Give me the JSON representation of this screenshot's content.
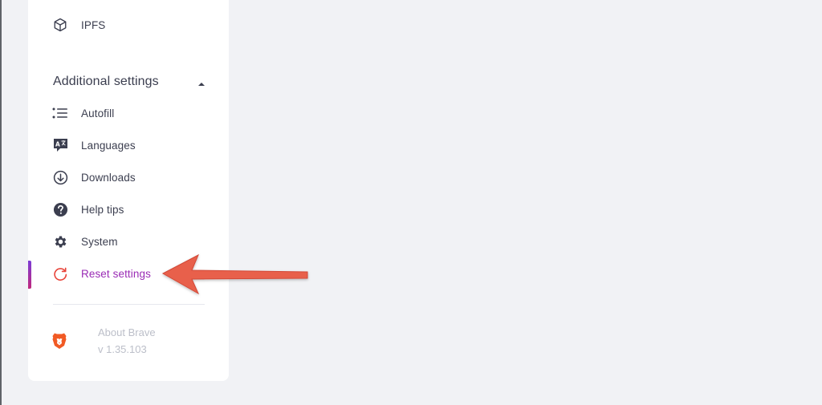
{
  "sidebar": {
    "ipfs_label": "IPFS",
    "additional_settings": {
      "title": "Additional settings",
      "expanded": true,
      "items": [
        {
          "label": "Autofill",
          "icon": "list-icon"
        },
        {
          "label": "Languages",
          "icon": "language-icon"
        },
        {
          "label": "Downloads",
          "icon": "download-icon"
        },
        {
          "label": "Help tips",
          "icon": "help-icon"
        },
        {
          "label": "System",
          "icon": "gear-icon"
        },
        {
          "label": "Reset settings",
          "icon": "reset-icon",
          "active": true
        }
      ]
    },
    "about": {
      "title": "About Brave",
      "version": "v 1.35.103"
    }
  },
  "colors": {
    "background": "#f1f2f5",
    "active_text": "#9a2bb5",
    "annotation_arrow": "#e8604c",
    "brave_orange": "#f15a24"
  }
}
